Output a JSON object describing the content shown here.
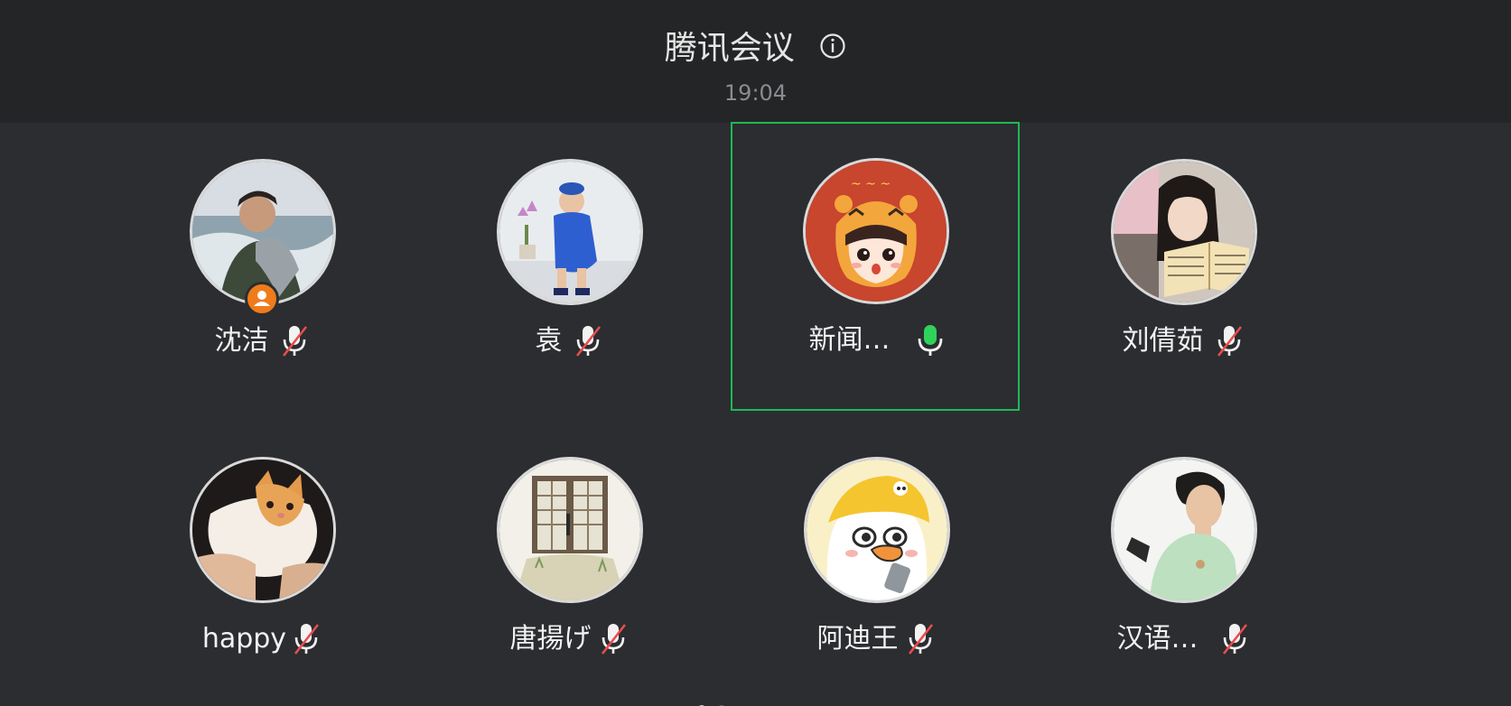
{
  "app": {
    "title": "腾讯会议",
    "time": "19:04"
  },
  "colors": {
    "active_border": "#1fb955",
    "mic_on": "#2fd35a",
    "mic_muted_slash": "#e84d4d",
    "host_badge": "#ef7b1a"
  },
  "participants": [
    {
      "name": "沈洁",
      "mic": "muted",
      "host": true,
      "active": false,
      "avatar_icon": "man-portrait-avatar"
    },
    {
      "name": "袁",
      "mic": "muted",
      "host": false,
      "active": false,
      "avatar_icon": "child-blue-outfit-avatar"
    },
    {
      "name": "新闻…",
      "mic": "on",
      "host": false,
      "active": true,
      "avatar_icon": "tiger-hat-cartoon-avatar"
    },
    {
      "name": "刘倩茹",
      "mic": "muted",
      "host": false,
      "active": false,
      "avatar_icon": "woman-reading-avatar"
    },
    {
      "name": "happy",
      "mic": "muted",
      "host": false,
      "active": false,
      "avatar_icon": "cat-avatar"
    },
    {
      "name": "唐揚げ",
      "mic": "muted",
      "host": false,
      "active": false,
      "avatar_icon": "doorway-scene-avatar"
    },
    {
      "name": "阿迪王",
      "mic": "muted",
      "host": false,
      "active": false,
      "avatar_icon": "duck-cartoon-avatar"
    },
    {
      "name": "汉语…",
      "mic": "muted",
      "host": false,
      "active": false,
      "avatar_icon": "boy-portrait-avatar"
    }
  ]
}
